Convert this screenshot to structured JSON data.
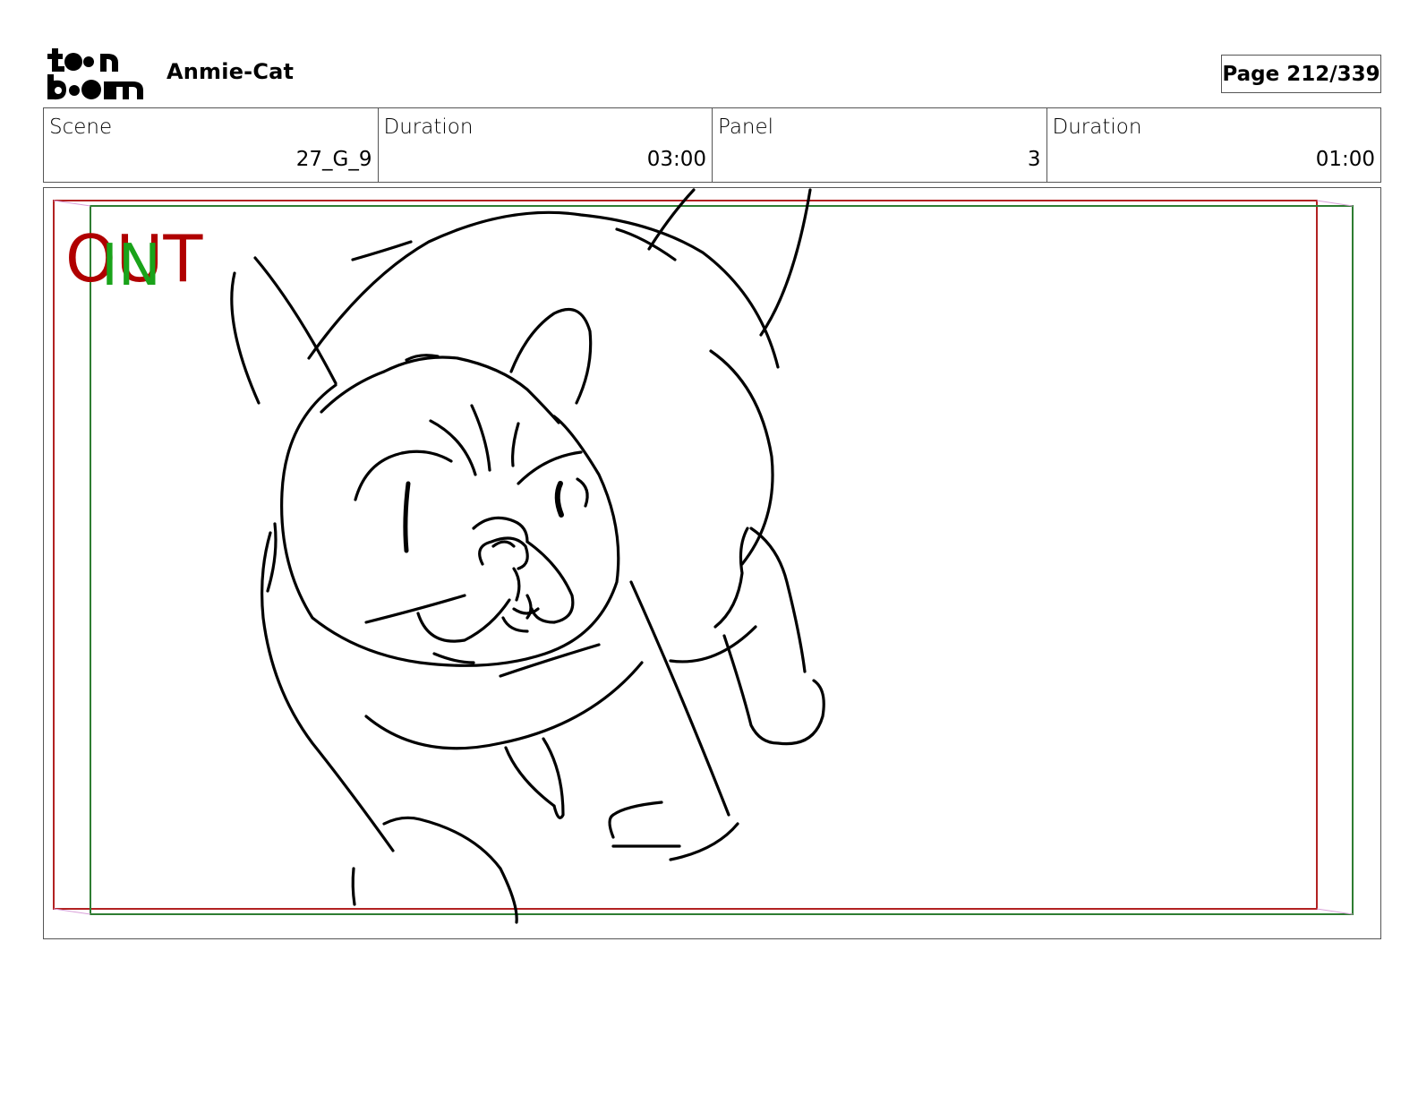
{
  "header": {
    "logo_alt": "toon boom",
    "project_title": "Anmie-Cat",
    "page_indicator": "Page 212/339"
  },
  "info": {
    "scene_label": "Scene",
    "scene_value": "27_G_9",
    "scene_duration_label": "Duration",
    "scene_duration_value": "03:00",
    "panel_label": "Panel",
    "panel_value": "3",
    "panel_duration_label": "Duration",
    "panel_duration_value": "01:00"
  },
  "panel": {
    "out_label": "OUT",
    "in_label": "IN",
    "out_color": "#b00000",
    "in_color": "#1aa31a",
    "frame_out_color": "#b22222",
    "frame_in_color": "#2e7d32"
  }
}
